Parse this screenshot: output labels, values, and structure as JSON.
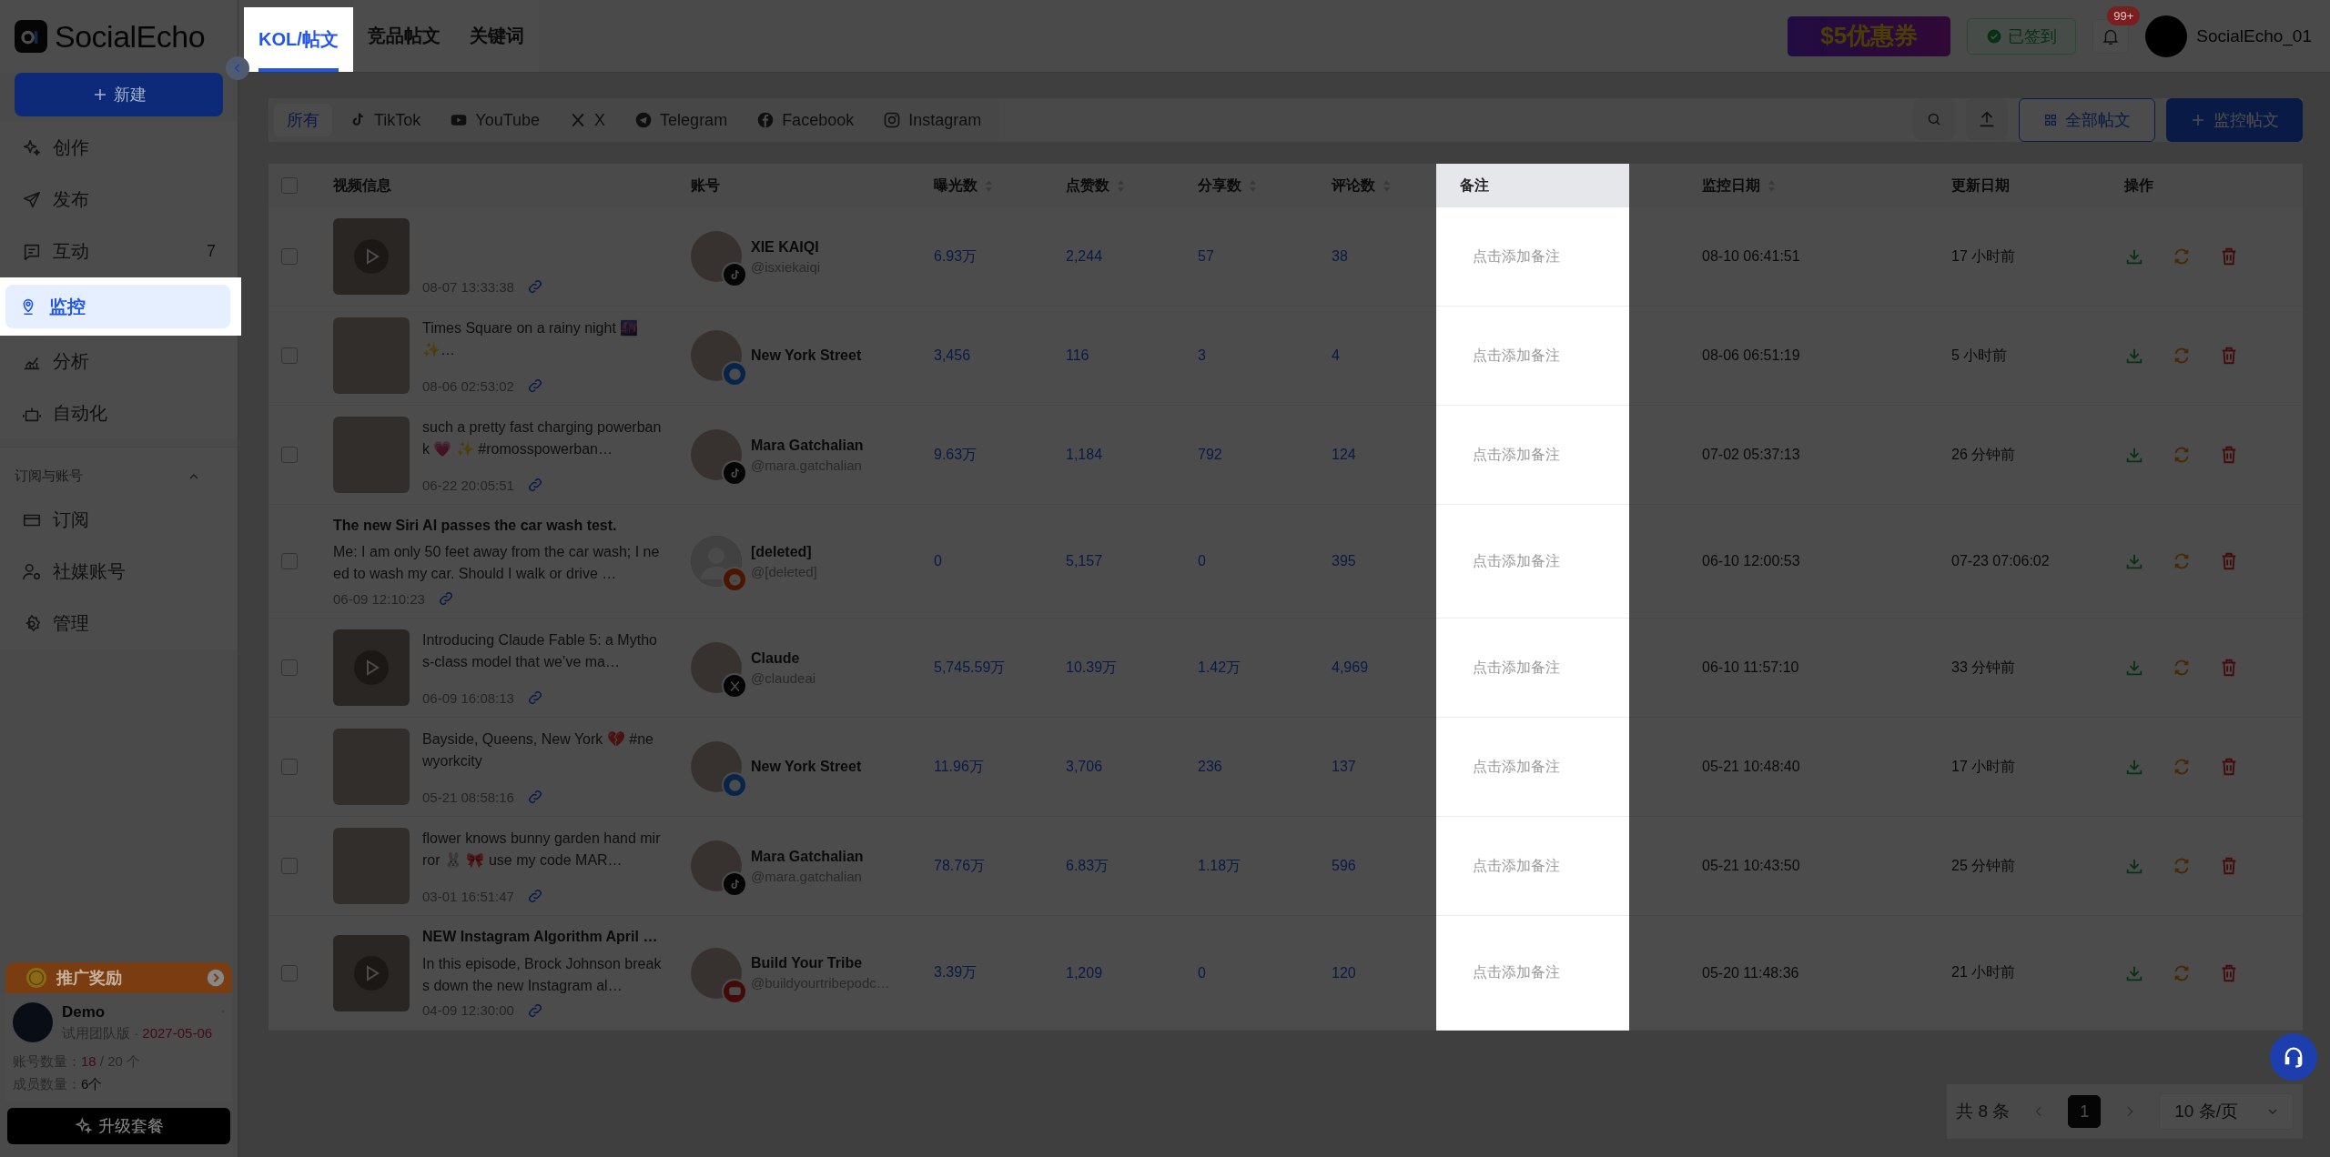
{
  "brand": {
    "name": "SocialEcho"
  },
  "sidebar": {
    "new_button": "新建",
    "items": [
      {
        "label": "创作",
        "selected": false
      },
      {
        "label": "发布",
        "selected": false
      },
      {
        "label": "互动",
        "badge": "7",
        "selected": false
      },
      {
        "label": "监控",
        "selected": true
      },
      {
        "label": "分析",
        "selected": false
      },
      {
        "label": "自动化",
        "selected": false
      }
    ],
    "section": {
      "title": "订阅与账号",
      "expanded": true,
      "items": [
        {
          "label": "订阅",
          "selected": false
        },
        {
          "label": "社媒账号",
          "selected": false
        },
        {
          "label": "管理",
          "selected": false
        }
      ]
    },
    "promo": "推广奖励",
    "user": {
      "name": "Demo",
      "plan": "试用团队版 ·",
      "expiry": "2027-05-06",
      "accounts_label": "账号数量：",
      "accounts_used": "18",
      "accounts_total": "/ 20 个",
      "members_label": "成员数量：",
      "members": "6个"
    },
    "upgrade": "升级套餐"
  },
  "header": {
    "tabs": [
      {
        "label": "KOL/帖文",
        "selected": true
      },
      {
        "label": "竞品帖文",
        "selected": false
      },
      {
        "label": "关键词",
        "selected": false
      }
    ],
    "coupon": "$5优惠券",
    "checkin": {
      "label": "已签到",
      "done": true
    },
    "notifications": "99+",
    "username": "SocialEcho_01"
  },
  "filters": [
    {
      "label": "所有",
      "kind": "all",
      "selected": true
    },
    {
      "label": "TikTok",
      "kind": "tiktok",
      "selected": false
    },
    {
      "label": "YouTube",
      "kind": "youtube",
      "selected": false
    },
    {
      "label": "X",
      "kind": "x",
      "selected": false
    },
    {
      "label": "Telegram",
      "kind": "telegram",
      "selected": false
    },
    {
      "label": "Facebook",
      "kind": "facebook",
      "selected": false
    },
    {
      "label": "Instagram",
      "kind": "instagram",
      "selected": false
    }
  ],
  "toolbar": {
    "all_posts": "全部帖文",
    "monitor": "监控帖文"
  },
  "table": {
    "all_checked": false,
    "columns": [
      {
        "label": "视频信息",
        "sortable": false
      },
      {
        "label": "账号",
        "sortable": false
      },
      {
        "label": "曝光数",
        "sortable": true
      },
      {
        "label": "点赞数",
        "sortable": true
      },
      {
        "label": "分享数",
        "sortable": true
      },
      {
        "label": "评论数",
        "sortable": true
      },
      {
        "label": "备注",
        "sortable": false
      },
      {
        "label": "监控日期",
        "sortable": true
      },
      {
        "label": "更新日期",
        "sortable": false
      },
      {
        "label": "操作",
        "sortable": false
      }
    ],
    "rows": [
      {
        "checked": false,
        "kind": "video",
        "date": "08-07 13:33:38",
        "account": {
          "name": "XIE KAIQI",
          "handle": "@isxiekaiqi",
          "kind": "tiktok",
          "avatar": {
            "kind": "photo"
          }
        },
        "views": "6.93万",
        "likes": "2,244",
        "shares": "57",
        "comments": "38",
        "note": "点击添加备注",
        "monitored": "08-10 06:41:51",
        "updated": "17 小时前"
      },
      {
        "checked": false,
        "kind": "image",
        "desc": "Times Square on a rainy night 🌆 ✨…",
        "date": "08-06 02:53:02",
        "account": {
          "name": "New York Street",
          "kind": "facebook",
          "avatar": {
            "kind": "photo"
          }
        },
        "views": "3,456",
        "likes": "116",
        "shares": "3",
        "comments": "4",
        "note": "点击添加备注",
        "monitored": "08-06 06:51:19",
        "updated": "5 小时前"
      },
      {
        "checked": false,
        "kind": "image",
        "desc": "such a pretty fast charging powerbank 💗 ✨ #romosspowerban…",
        "date": "06-22 20:05:51",
        "account": {
          "name": "Mara Gatchalian",
          "handle": "@mara.gatchalian",
          "kind": "tiktok",
          "avatar": {
            "kind": "photo"
          }
        },
        "views": "9.63万",
        "likes": "1,184",
        "shares": "792",
        "comments": "124",
        "note": "点击添加备注",
        "monitored": "07-02 05:37:13",
        "updated": "26 分钟前"
      },
      {
        "checked": false,
        "kind": "text",
        "title": "The new Siri AI passes the car wash test.",
        "desc": "Me: I am only 50 feet away from the car wash; I need to wash my car. Should I walk or drive …",
        "date": "06-09 12:10:23",
        "account": {
          "name": "[deleted]",
          "handle": "@[deleted]",
          "kind": "reddit",
          "avatar": {
            "kind": "silhouette"
          }
        },
        "views": "0",
        "likes": "5,157",
        "shares": "0",
        "comments": "395",
        "note": "点击添加备注",
        "monitored": "06-10 12:00:53",
        "updated": "07-23 07:06:02"
      },
      {
        "checked": false,
        "kind": "video",
        "desc": "Introducing Claude Fable 5: a Mythos-class model that we’ve ma…",
        "date": "06-09 16:08:13",
        "account": {
          "name": "Claude",
          "handle": "@claudeai",
          "kind": "x",
          "avatar": {
            "kind": "photo"
          }
        },
        "views": "5,745.59万",
        "likes": "10.39万",
        "shares": "1.42万",
        "comments": "4,969",
        "note": "点击添加备注",
        "monitored": "06-10 11:57:10",
        "updated": "33 分钟前"
      },
      {
        "checked": false,
        "kind": "image",
        "desc": "Bayside, Queens, New York 💔 #newyorkcity",
        "date": "05-21 08:58:16",
        "account": {
          "name": "New York Street",
          "kind": "facebook",
          "avatar": {
            "kind": "photo"
          }
        },
        "views": "11.96万",
        "likes": "3,706",
        "shares": "236",
        "comments": "137",
        "note": "点击添加备注",
        "monitored": "05-21 10:48:40",
        "updated": "17 小时前"
      },
      {
        "checked": false,
        "kind": "image",
        "desc": "flower knows bunny garden hand mirror 🐰 🎀 use my code MAR…",
        "date": "03-01 16:51:47",
        "account": {
          "name": "Mara Gatchalian",
          "handle": "@mara.gatchalian",
          "kind": "tiktok",
          "avatar": {
            "kind": "photo"
          }
        },
        "views": "78.76万",
        "likes": "6.83万",
        "shares": "1.18万",
        "comments": "596",
        "note": "点击添加备注",
        "monitored": "05-21 10:43:50",
        "updated": "25 分钟前"
      },
      {
        "checked": false,
        "kind": "video",
        "title": "NEW Instagram Algorithm April …",
        "desc": "In this episode, Brock Johnson breaks down the new Instagram al…",
        "date": "04-09 12:30:00",
        "account": {
          "name": "Build Your Tribe",
          "handle": "@buildyourtribepodc…",
          "kind": "youtube",
          "avatar": {
            "kind": "photo"
          }
        },
        "views": "3.39万",
        "likes": "1,209",
        "shares": "0",
        "comments": "120",
        "note": "点击添加备注",
        "monitored": "05-20 11:48:36",
        "updated": "21 小时前"
      }
    ]
  },
  "pagination": {
    "total": "共 8 条",
    "pages": [
      {
        "label": "1",
        "selected": true
      }
    ],
    "page_size": "10 条/页"
  }
}
